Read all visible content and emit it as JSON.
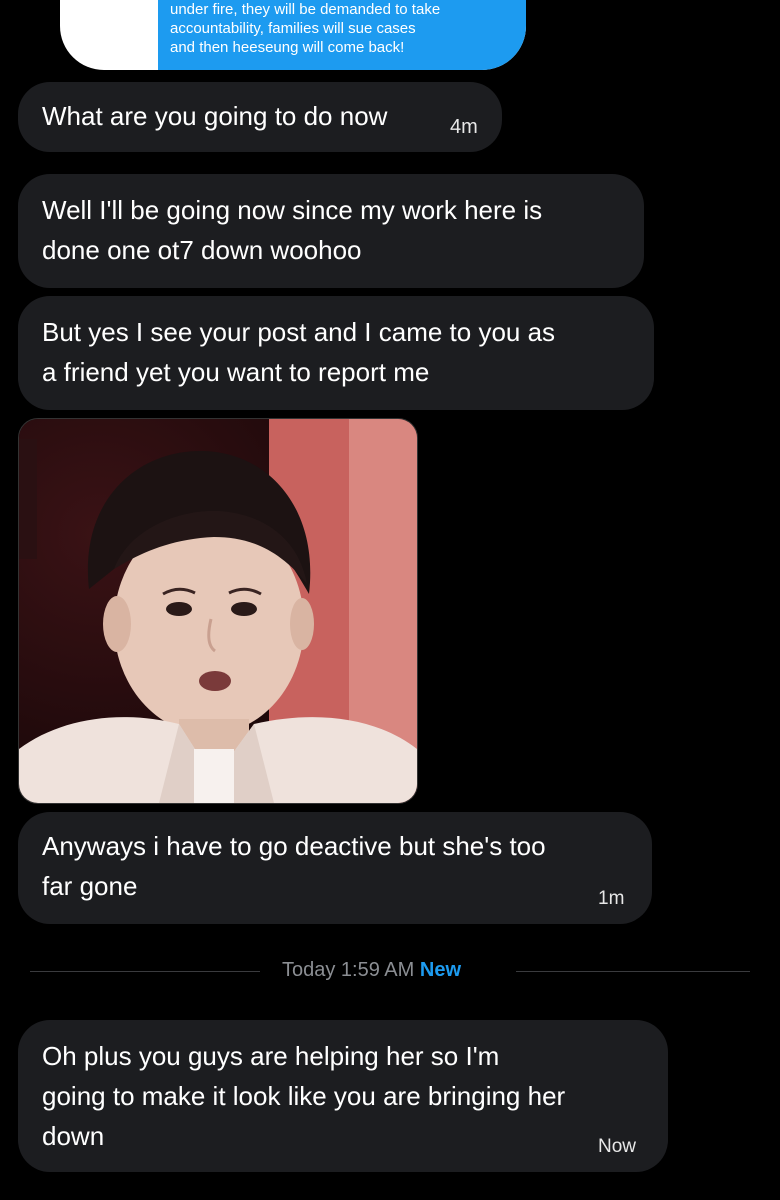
{
  "quoted": {
    "lines": [
      "under fire, they will be demanded to take",
      "accountability, families will sue cases",
      "and then heeseung will come back!"
    ]
  },
  "messages": [
    {
      "lines": [
        "What are you going to do now"
      ],
      "time": "4m"
    },
    {
      "lines": [
        "Well I'll be going now since my work here is",
        "done one ot7 down woohoo"
      ],
      "time": ""
    },
    {
      "lines": [
        "But yes I see your post and I came to you as",
        "a friend yet you want to report me"
      ],
      "time": ""
    },
    {
      "lines": [
        "Anyways i have to go deactive but she's too",
        "far gone"
      ],
      "time": "1m"
    },
    {
      "lines": [
        "Oh plus you guys are helping her so I'm",
        "going to make it look like you are bringing her",
        "down"
      ],
      "time": "Now"
    }
  ],
  "divider": {
    "label": "Today 1:59 AM",
    "new_label": "New"
  },
  "colors": {
    "accent": "#1d9bf0",
    "bubble": "#1c1d20",
    "background": "#000000"
  }
}
